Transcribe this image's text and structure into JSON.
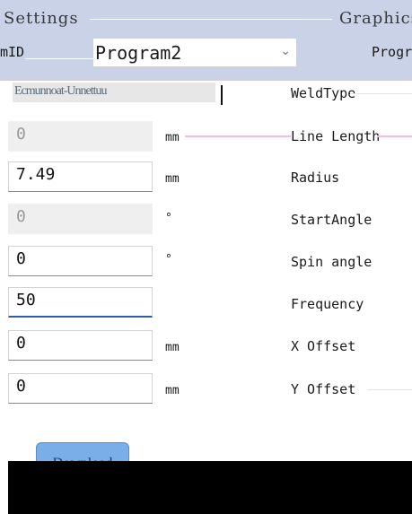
{
  "header": {
    "tab_settings": "Settings",
    "tab_graphics": "Graphics",
    "program_id_label": "mID",
    "program_right_label": "Progra"
  },
  "program": {
    "selected": "Program2"
  },
  "weld": {
    "type_value_garbled": "Ecmunnoat-Unnettuu",
    "type_label": "WeldType"
  },
  "fields": [
    {
      "value": "0",
      "unit": "mm",
      "label": "Line Length",
      "disabled": true
    },
    {
      "value": "7.49",
      "unit": "mm",
      "label": "Radius",
      "disabled": false
    },
    {
      "value": "0",
      "unit": "°",
      "label": "StartAngle",
      "disabled": true
    },
    {
      "value": "0",
      "unit": "°",
      "label": "Spin angle",
      "disabled": false
    },
    {
      "value": "50",
      "unit": "",
      "label": "Frequency",
      "disabled": false
    },
    {
      "value": "0",
      "unit": "mm",
      "label": "X Offset",
      "disabled": false
    },
    {
      "value": "0",
      "unit": "mm",
      "label": "Y Offset",
      "disabled": false
    }
  ],
  "button": {
    "label": "Download"
  },
  "icons": {
    "chevron": "chevron-down-icon"
  }
}
